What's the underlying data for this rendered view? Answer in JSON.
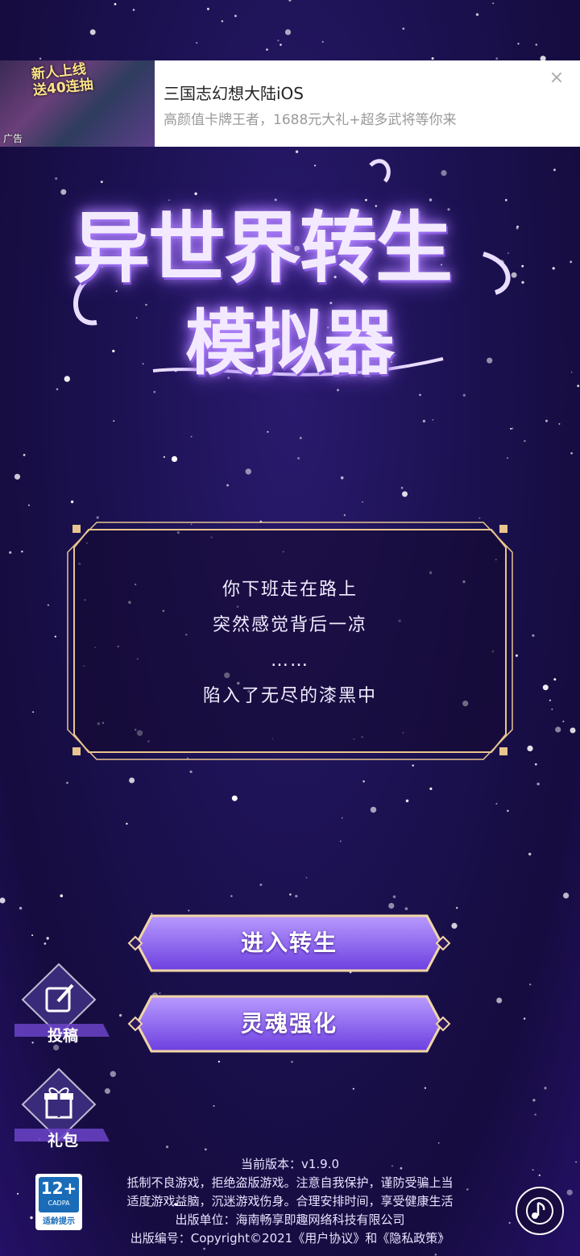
{
  "ad": {
    "thumb_text_line1": "新人上线",
    "thumb_text_line2": "送40连抽",
    "thumb_tag": "广告",
    "title": "三国志幻想大陆iOS",
    "subtitle": "高颜值卡牌王者，1688元大礼+超多武将等你来",
    "close_icon": "×"
  },
  "logo": {
    "line1": "异世界转生",
    "line2": "模拟器"
  },
  "story": {
    "lines": [
      "你下班走在路上",
      "突然感觉背后一凉",
      "……",
      "陷入了无尽的漆黑中"
    ]
  },
  "buttons": {
    "enter": "进入转生",
    "soul": "灵魂强化"
  },
  "side": {
    "submit": "投稿",
    "gift": "礼包"
  },
  "footer": {
    "version": "当前版本：v1.9.0",
    "notice1": "抵制不良游戏，拒绝盗版游戏。注意自我保护，谨防受骗上当",
    "notice2": "适度游戏益脑，沉迷游戏伤身。合理安排时间，享受健康生活",
    "publisher": "出版单位：海南畅享即趣网络科技有限公司",
    "license": "出版编号：Copyright©2021《用户协议》和《隐私政策》"
  },
  "age_rating": {
    "number": "12+",
    "org": "CADPA",
    "tip": "适龄提示"
  },
  "icons": {
    "music": "music-note-icon",
    "edit": "edit-icon",
    "gift": "gift-icon"
  },
  "colors": {
    "background": "#1b1150",
    "accent": "#8a5cf0",
    "frame_gold": "#e8c48f"
  }
}
